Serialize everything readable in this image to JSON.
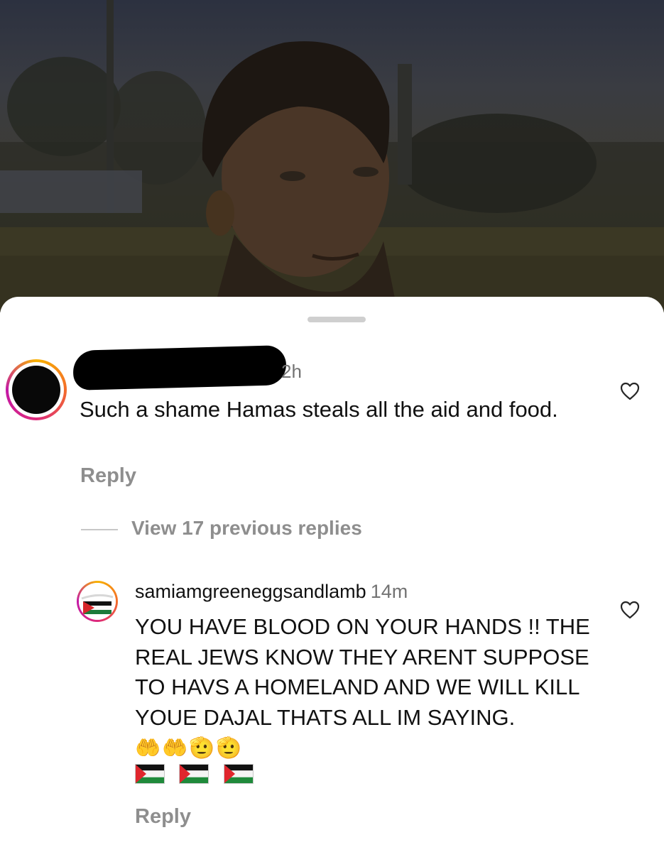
{
  "media": {
    "description_icon": "video-frame"
  },
  "comments": [
    {
      "username": "",
      "time": "2h",
      "text": "Such a shame Hamas steals all the aid and food.",
      "reply_label": "Reply",
      "like_icon": "heart-outline-icon"
    },
    {
      "username": "samiamgreeneggsandlamb",
      "time": "14m",
      "text": "YOU HAVE BLOOD ON YOUR HANDS !! THE REAL JEWS KNOW THEY ARENT SUPPOSE TO HAVS A HOMELAND AND WE WILL KILL YOUE DAJAL THATS ALL IM SAYING.",
      "emojis": "🤲🤲🫡🫡",
      "flags": [
        "palestine-flag",
        "palestine-flag",
        "palestine-flag"
      ],
      "reply_label": "Reply",
      "like_icon": "heart-outline-icon"
    }
  ],
  "thread": {
    "view_replies_label": "View 17 previous replies"
  },
  "colors": {
    "secondary_text": "#8e8e8e",
    "story_ring_start": "#f8b200",
    "story_ring_end": "#c318a6"
  }
}
